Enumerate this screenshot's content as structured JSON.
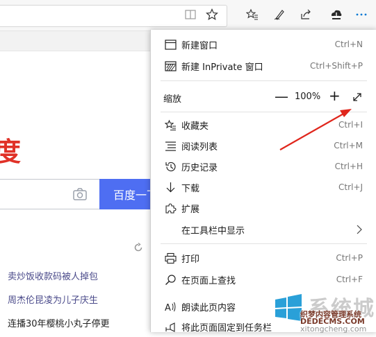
{
  "toolbar": {
    "icons": [
      "reading-view-icon",
      "favorite-star-icon",
      "favorites-icon",
      "pen-icon",
      "share-icon",
      "download-icon",
      "more-icon"
    ],
    "accent": "#0078d4"
  },
  "page": {
    "logo_fragment": "度",
    "search_button": "百度一下",
    "news": [
      "卖炒饭收款码被人掉包",
      "周杰伦昆凌为儿子庆生",
      "连播30年樱桃小丸子停更"
    ],
    "colors": {
      "brand_red": "#e03127",
      "search_blue": "#4e6ef2"
    }
  },
  "menu": {
    "new_window": {
      "label": "新建窗口",
      "shortcut": "Ctrl+N"
    },
    "new_private": {
      "label": "新建 InPrivate 窗口",
      "shortcut": "Ctrl+Shift+P"
    },
    "zoom": {
      "label": "缩放",
      "minus": "—",
      "value": "100%",
      "plus": "+"
    },
    "favorites": {
      "label": "收藏夹",
      "shortcut": "Ctrl+I"
    },
    "reading_list": {
      "label": "阅读列表",
      "shortcut": "Ctrl+M"
    },
    "history": {
      "label": "历史记录",
      "shortcut": "Ctrl+H"
    },
    "downloads": {
      "label": "下载",
      "shortcut": "Ctrl+J"
    },
    "extensions": {
      "label": "扩展"
    },
    "show_in_toolbar": {
      "label": "在工具栏中显示"
    },
    "print": {
      "label": "打印",
      "shortcut": "Ctrl+P"
    },
    "find": {
      "label": "在页面上查找",
      "shortcut": "Ctrl+F"
    },
    "read_aloud": {
      "label": "朗读此页内容"
    },
    "pin_taskbar": {
      "label": "将此页面固定到任务栏"
    }
  },
  "watermark": {
    "big_text": "系统城",
    "line1": "织梦内容管理系统",
    "line2": "DEDECMS.COM",
    "url": "xitongcheng.com"
  }
}
